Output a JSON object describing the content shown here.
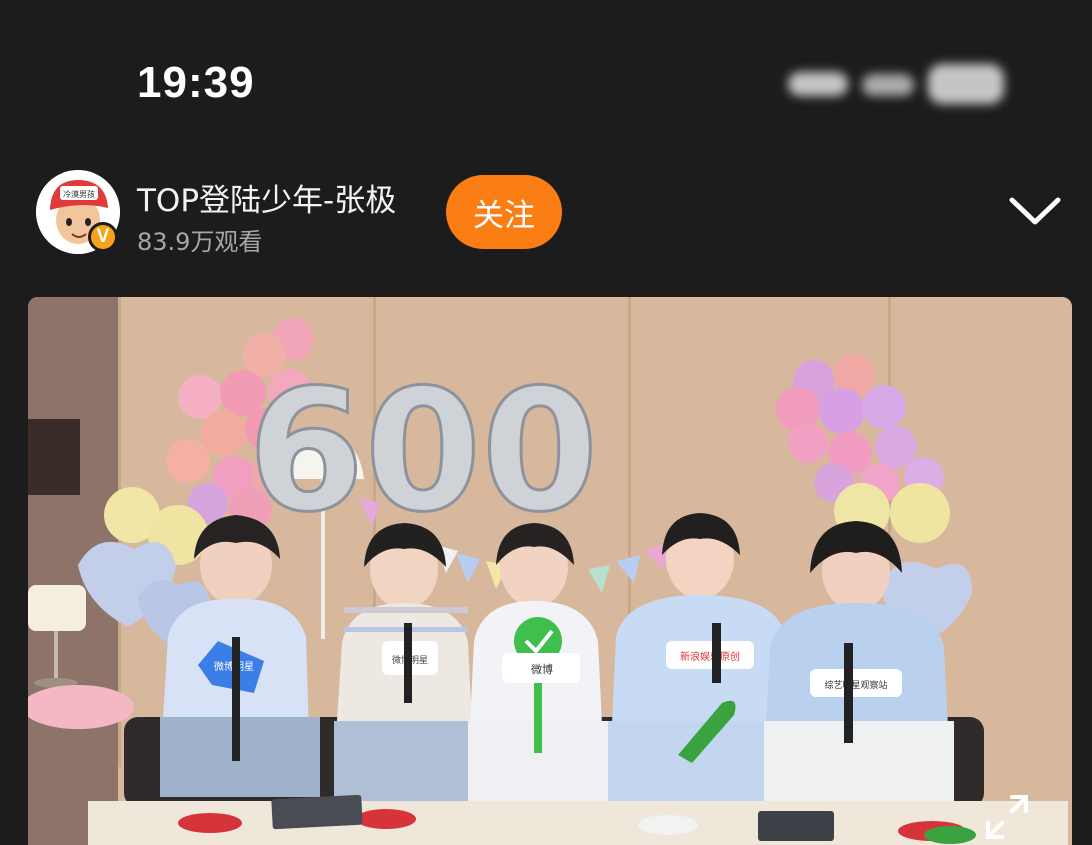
{
  "status_bar": {
    "time": "19:39",
    "icons": [
      "signal-icon",
      "wifi-icon",
      "battery-icon"
    ]
  },
  "header": {
    "user_name": "TOP登陆少年-张极",
    "view_count": "83.9万观看",
    "follow_label": "关注",
    "verified_mark": "V",
    "avatar_cap_text": "冷漠男孩",
    "collapse_icon": "chevron-down-icon"
  },
  "video": {
    "balloon_number": "600",
    "sign_labels": {
      "star_sign": "微博明星",
      "sign_weibo_star": "微博明星",
      "sign_weibo": "微博",
      "sign_sina_music": "新浪娱乐原创",
      "sign_variety": "综艺明星观察站"
    },
    "fullscreen_icon": "expand-icon"
  },
  "colors": {
    "background": "#1c1c1c",
    "accent_follow": "#fb7e14",
    "verified_badge": "#f7a218",
    "secondary_text": "#a7a7a7"
  }
}
